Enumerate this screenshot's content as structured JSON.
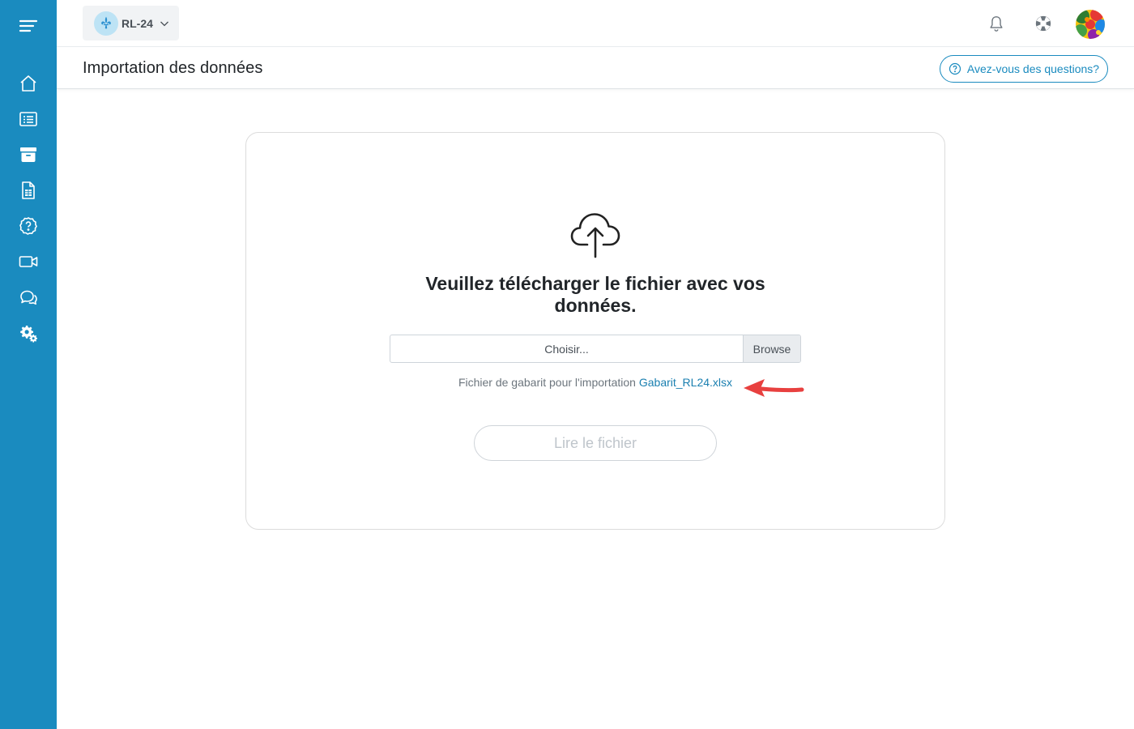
{
  "sidebar": {
    "items": [
      {
        "icon": "menu-icon"
      },
      {
        "icon": "home-icon"
      },
      {
        "icon": "list-icon"
      },
      {
        "icon": "archive-icon"
      },
      {
        "icon": "spreadsheet-icon"
      },
      {
        "icon": "help-icon"
      },
      {
        "icon": "video-icon"
      },
      {
        "icon": "chat-icon"
      },
      {
        "icon": "settings-icon"
      }
    ],
    "color": "#1a8bbf"
  },
  "topbar": {
    "form_selector": "RL-24",
    "notification_icon": "bell-icon",
    "support_icon": "lifebuoy-icon",
    "avatar_icon": "avatar"
  },
  "page": {
    "title": "Importation des données",
    "help_button": "Avez-vous des questions?"
  },
  "upload": {
    "headline_line1": "Veuillez télécharger le fichier avec vos",
    "headline_line2": "données.",
    "file_placeholder": "Choisir...",
    "browse_label": "Browse",
    "template_text": "Fichier de gabarit pour l'importation",
    "template_link": "Gabarit_RL24.xlsx",
    "read_button": "Lire le fichier"
  },
  "colors": {
    "accent": "#1a8bbf",
    "arrow": "#e8403f"
  }
}
